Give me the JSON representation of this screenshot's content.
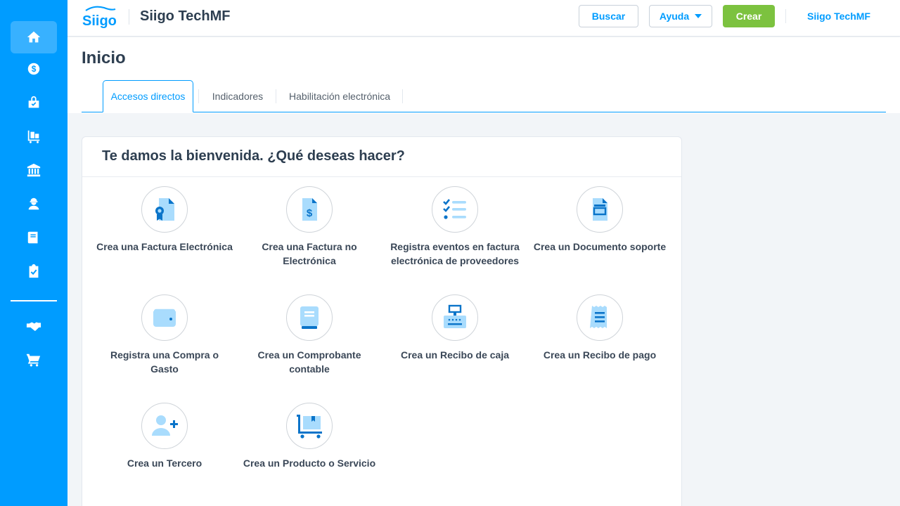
{
  "sidebar": {
    "items": [
      {
        "name": "home-icon"
      },
      {
        "name": "dollar-icon"
      },
      {
        "name": "shopping-bag-icon"
      },
      {
        "name": "inventory-cart-icon"
      },
      {
        "name": "bank-icon"
      },
      {
        "name": "employee-icon"
      },
      {
        "name": "book-icon"
      },
      {
        "name": "clipboard-check-icon"
      },
      {
        "name": "handshake-icon"
      },
      {
        "name": "shopping-cart-icon"
      }
    ]
  },
  "header": {
    "logo_text": "Siigo",
    "company_title": "Siigo TechMF",
    "search_label": "Buscar",
    "help_label": "Ayuda",
    "create_label": "Crear",
    "company_link": "Siigo TechMF"
  },
  "page": {
    "title": "Inicio",
    "tabs": [
      {
        "label": "Accesos directos"
      },
      {
        "label": "Indicadores"
      },
      {
        "label": "Habilitación electrónica"
      }
    ]
  },
  "welcome": {
    "title": "Te damos la bienvenida. ¿Qué deseas hacer?",
    "actions": [
      {
        "label": "Crea una Factura Electrónica",
        "icon": "certified-invoice-icon"
      },
      {
        "label": "Crea una Factura no Electrónica",
        "icon": "dollar-invoice-icon"
      },
      {
        "label": "Registra eventos en factura electrónica de proveedores",
        "icon": "checklist-icon"
      },
      {
        "label": "Crea un Documento soporte",
        "icon": "support-document-icon"
      },
      {
        "label": "Registra una Compra o Gasto",
        "icon": "wallet-icon"
      },
      {
        "label": "Crea un Comprobante contable",
        "icon": "ledger-book-icon"
      },
      {
        "label": "Crea un Recibo de caja",
        "icon": "cash-register-icon"
      },
      {
        "label": "Crea un Recibo de pago",
        "icon": "receipt-icon"
      },
      {
        "label": "Crea un Tercero",
        "icon": "add-user-icon"
      },
      {
        "label": "Crea un Producto o Servicio",
        "icon": "product-cart-icon"
      }
    ]
  },
  "colors": {
    "primary": "#009cff",
    "create": "#7cc23f",
    "icon_light": "#a9dcfd",
    "icon_dark": "#0a74c9"
  }
}
